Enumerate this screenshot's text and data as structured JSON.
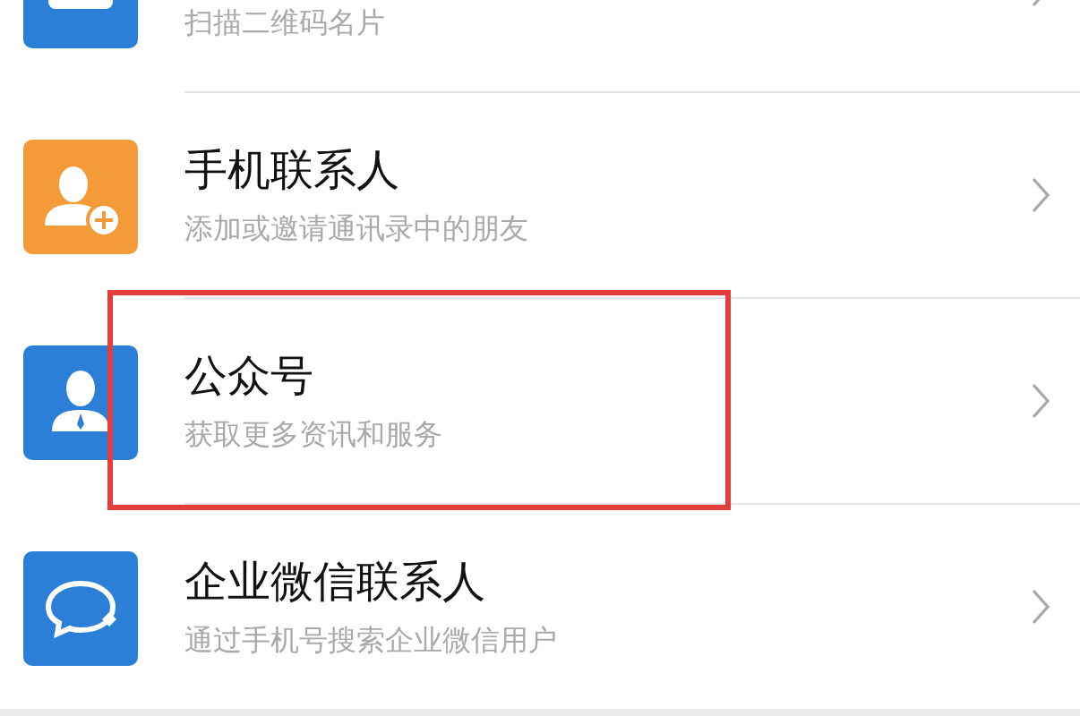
{
  "items": [
    {
      "kind": "card",
      "color": "#2b7fd6",
      "subtitle": "扫描二维码名片",
      "highlighted": false
    },
    {
      "kind": "contact-add",
      "color": "#f59a38",
      "title": "手机联系人",
      "subtitle": "添加或邀请通讯录中的朋友",
      "highlighted": false
    },
    {
      "kind": "account",
      "color": "#2b7fd6",
      "title": "公众号",
      "subtitle": "获取更多资讯和服务",
      "highlighted": true
    },
    {
      "kind": "chat",
      "color": "#2b7fd6",
      "title": "企业微信联系人",
      "subtitle": "通过手机号搜索企业微信用户",
      "highlighted": false
    }
  ]
}
